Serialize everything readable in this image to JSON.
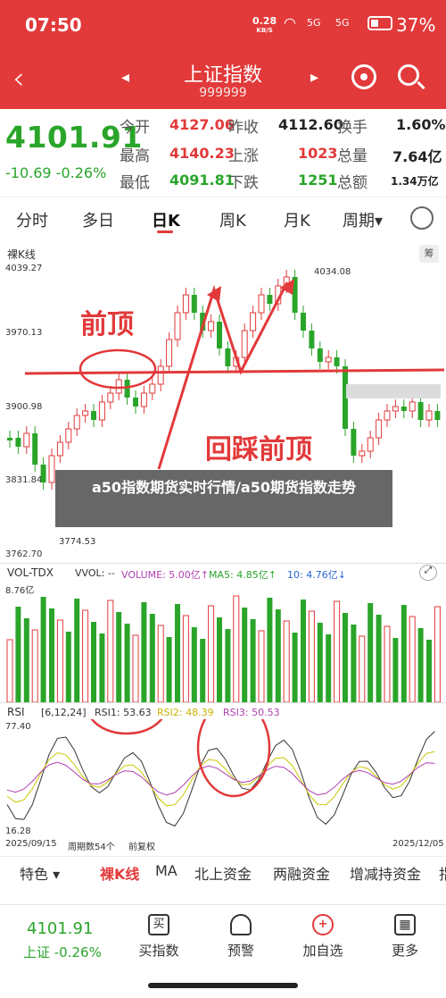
{
  "status": {
    "time": "07:50",
    "net_speed": "0.28",
    "net_unit": "KB/S",
    "sig1": "5G",
    "sig2": "5G",
    "battery": "37%"
  },
  "header": {
    "title": "上证指数",
    "code": "999999"
  },
  "quote": {
    "price": "4101.91",
    "change": "-10.69  -0.26%",
    "cols": [
      {
        "l1": "今开",
        "v1": "4127.06",
        "l2": "最高",
        "v2": "4140.23",
        "l3": "最低",
        "v3": "4091.81"
      },
      {
        "l1": "昨收",
        "v1": "4112.60",
        "l2": "上涨",
        "v2": "1023",
        "l3": "下跌",
        "v3": "1251"
      },
      {
        "l1": "换手",
        "v1": "1.60%",
        "l2": "总量",
        "v2": "7.64亿",
        "l3": "总额",
        "v3": "1.34万亿"
      }
    ]
  },
  "tabs": [
    "分时",
    "多日",
    "日K",
    "周K",
    "月K",
    "周期▾"
  ],
  "kline": {
    "label": "裸K线",
    "y_labels": [
      "4039.27",
      "3970.13",
      "3900.98",
      "3831.84",
      "3762.70"
    ],
    "high_label": "4034.08",
    "low_label": "3774.53",
    "badge": "筹",
    "annotation1": "前顶",
    "annotation2": "回踩前顶"
  },
  "vol": {
    "label": "VOL-TDX",
    "vvol": "VVOL: --",
    "volume": "VOLUME: 5.00亿↑",
    "ma5": "MA5: 4.85亿↑",
    "ma10": "10: 4.76亿↓",
    "top": "8.76亿"
  },
  "rsi": {
    "label": "RSI",
    "params": "[6,12,24]",
    "rsi1": "RSI1: 53.63",
    "rsi2": "RSI2: 48.39",
    "rsi3": "RSI3: 50.53",
    "top": "77.40",
    "bottom": "16.28"
  },
  "dates": {
    "start": "2025/09/15",
    "mid1": "周期数54个",
    "mid2": "前复权",
    "end": "2025/12/05"
  },
  "overlay": "a50指数期货实时行情/a50期货指数走势",
  "indicators": [
    "特色 ▾",
    "裸K线",
    "MA",
    "北上资金",
    "两融资金",
    "增减持资金",
    "指"
  ],
  "bottom": {
    "price": "4101.91",
    "sub": "上证 -0.26%",
    "items": [
      "买指数",
      "预警",
      "加自选",
      "更多"
    ],
    "icons": [
      "买",
      "🔔",
      "+",
      "▦"
    ]
  },
  "colors": {
    "red": "#e2393a",
    "green": "#2aa52a"
  }
}
